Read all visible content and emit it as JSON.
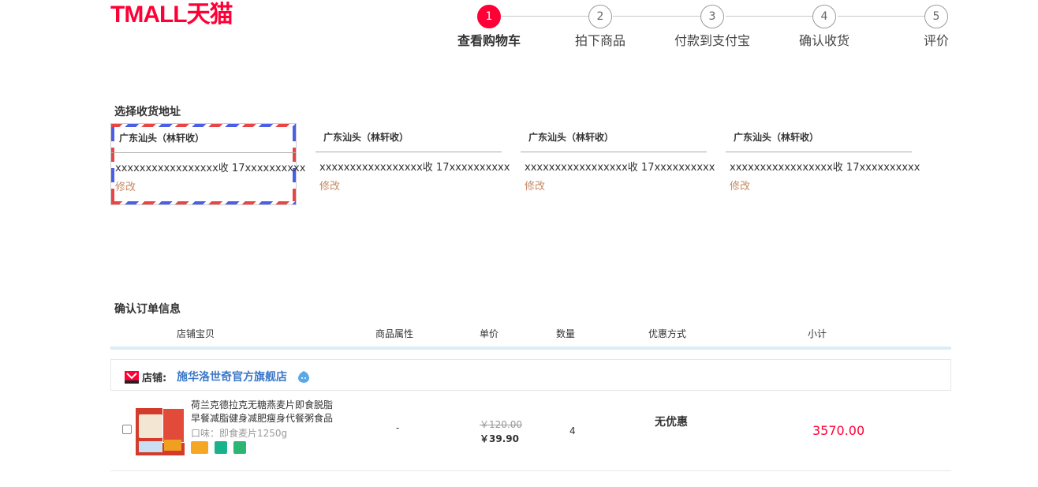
{
  "logo": "TMALL天猫",
  "steps": [
    {
      "num": "1",
      "label": "查看购物车"
    },
    {
      "num": "2",
      "label": "拍下商品"
    },
    {
      "num": "3",
      "label": "付款到支付宝"
    },
    {
      "num": "4",
      "label": "确认收货"
    },
    {
      "num": "5",
      "label": "评价"
    }
  ],
  "address_section": {
    "title": "选择收货地址",
    "addresses": [
      {
        "name": "广东汕头（林轩收）",
        "street": "xxxxxxxxxxxxxxxxx收 17xxxxxxxxxx",
        "edit": "修改"
      },
      {
        "name": "广东汕头（林轩收）",
        "street": "xxxxxxxxxxxxxxxxx收 17xxxxxxxxxx",
        "edit": "修改"
      },
      {
        "name": "广东汕头（林轩收）",
        "street": "xxxxxxxxxxxxxxxxx收 17xxxxxxxxxx",
        "edit": "修改"
      },
      {
        "name": "广东汕头（林轩收）",
        "street": "xxxxxxxxxxxxxxxxx收 17xxxxxxxxxx",
        "edit": "修改"
      }
    ]
  },
  "order_section": {
    "title": "确认订单信息",
    "columns": [
      "店铺宝贝",
      "商品属性",
      "单价",
      "数量",
      "优惠方式",
      "小计"
    ],
    "shop": {
      "label": "店铺:",
      "name": "施华洛世奇官方旗舰店"
    },
    "item": {
      "title": "荷兰克德拉克无糖燕麦片即食脱脂早餐减脂健身减肥瘦身代餐粥食品",
      "attr": "口味：即食麦片1250g",
      "property": "-",
      "price_old": "￥120.00",
      "price_now": "￥39.90",
      "quantity": "4",
      "discount": "无优惠",
      "subtotal": "3570.00"
    }
  },
  "colors": {
    "brand": "#ff0036",
    "shop_link": "#3c78c8",
    "edit_link": "#c48a66"
  }
}
